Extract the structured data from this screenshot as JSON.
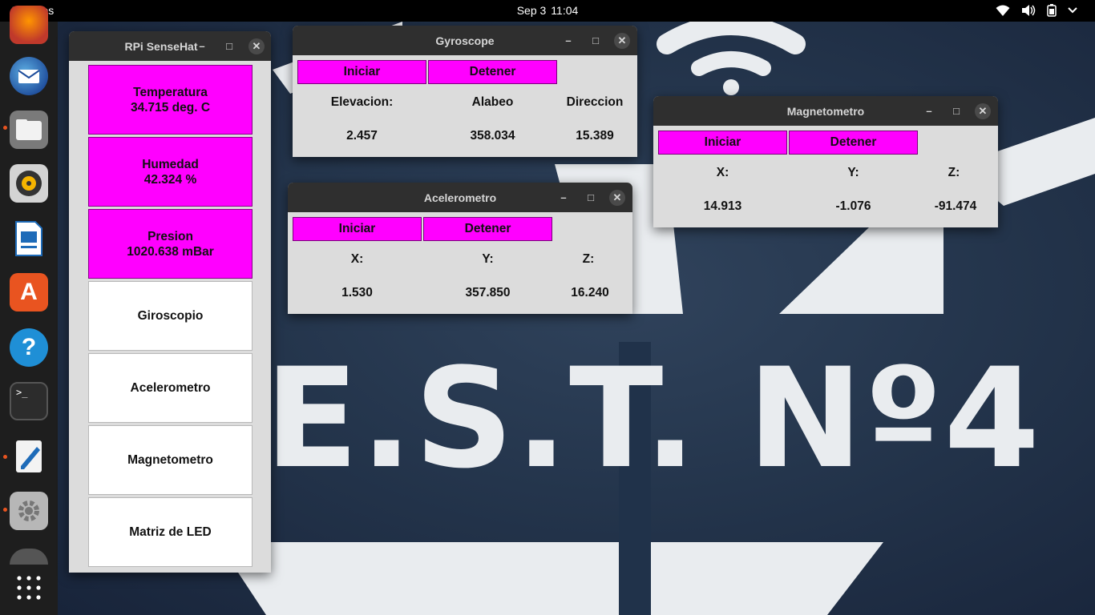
{
  "topbar": {
    "activities": "Activities",
    "date": "Sep 3",
    "time": "11:04",
    "icons": [
      "wifi-icon",
      "volume-icon",
      "battery-icon",
      "system-menu-chevron-icon"
    ]
  },
  "dock": {
    "apps": [
      "firefox",
      "thunderbird",
      "files",
      "rhythmbox",
      "libreoffice-impress",
      "app-center",
      "help",
      "terminal",
      "text-editor",
      "settings",
      "disk",
      "show-apps"
    ]
  },
  "desktop": {
    "wallpaper_text": "E.S.T. Nº4"
  },
  "sensehat": {
    "title": "RPi SenseHat",
    "temperature": {
      "label": "Temperatura",
      "value": "34.715 deg. C"
    },
    "humidity": {
      "label": "Humedad",
      "value": "42.324 %"
    },
    "pressure": {
      "label": "Presion",
      "value": "1020.638 mBar"
    },
    "buttons": [
      "Giroscopio",
      "Acelerometro",
      "Magnetometro",
      "Matriz de LED"
    ]
  },
  "gyroscope": {
    "title": "Gyroscope",
    "start": "Iniciar",
    "stop": "Detener",
    "headers": [
      "Elevacion:",
      "Alabeo",
      "Direccion"
    ],
    "values": [
      "2.457",
      "358.034",
      "15.389"
    ]
  },
  "accelerometer": {
    "title": "Acelerometro",
    "start": "Iniciar",
    "stop": "Detener",
    "headers": [
      "X:",
      "Y:",
      "Z:"
    ],
    "values": [
      "1.530",
      "357.850",
      "16.240"
    ]
  },
  "magnetometer": {
    "title": "Magnetometro",
    "start": "Iniciar",
    "stop": "Detener",
    "headers": [
      "X:",
      "Y:",
      "Z:"
    ],
    "values": [
      "14.913",
      "-1.076",
      "-91.474"
    ]
  },
  "window_controls": {
    "minimize": "–",
    "maximize": "□",
    "close": "✕"
  },
  "colors": {
    "accent": "#ff00ff",
    "dock_indicator": "#e95420",
    "titlebar": "#2f2f2f"
  }
}
